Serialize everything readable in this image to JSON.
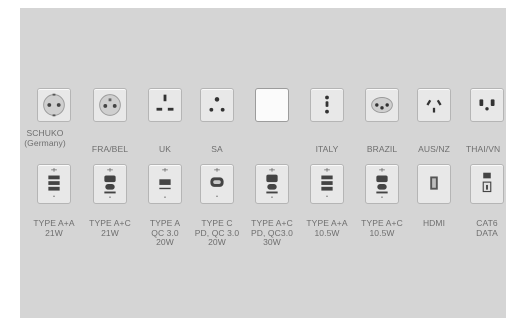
{
  "outlets": [
    {
      "id": "schuko",
      "icon": "schuko-socket-icon",
      "lines": [
        "SCHUKO",
        "(Germany)"
      ]
    },
    {
      "id": "frabel",
      "icon": "fra-bel-socket-icon",
      "lines": [
        "FRA/BEL"
      ]
    },
    {
      "id": "uk",
      "icon": "uk-socket-icon",
      "lines": [
        "UK"
      ]
    },
    {
      "id": "sa",
      "icon": "sa-socket-icon",
      "lines": [
        "SA"
      ]
    },
    {
      "id": "blank",
      "icon": "blank-plate-icon",
      "lines": []
    },
    {
      "id": "italy",
      "icon": "italy-socket-icon",
      "lines": [
        "ITALY"
      ]
    },
    {
      "id": "brazil",
      "icon": "brazil-socket-icon",
      "lines": [
        "BRAZIL"
      ]
    },
    {
      "id": "ausnz",
      "icon": "aus-nz-socket-icon",
      "lines": [
        "AUS/NZ"
      ]
    },
    {
      "id": "thai",
      "icon": "thai-socket-icon",
      "lines": [
        "THAI/VN"
      ]
    }
  ],
  "modules": [
    {
      "id": "typeaa21",
      "icon": "usb-a-a-module-icon",
      "lines": [
        "TYPE A+A",
        "21W"
      ]
    },
    {
      "id": "typeac21",
      "icon": "usb-a-c-module-icon",
      "lines": [
        "TYPE A+C",
        "21W"
      ]
    },
    {
      "id": "typeaqc",
      "icon": "usb-a-qc-module-icon",
      "lines": [
        "TYPE A",
        "QC 3.0",
        "20W"
      ]
    },
    {
      "id": "typecpd",
      "icon": "usb-c-pd-module-icon",
      "lines": [
        "TYPE C",
        "PD, QC 3.0",
        "20W"
      ]
    },
    {
      "id": "typeacpd",
      "icon": "usb-a-c-pd-module-icon",
      "lines": [
        "TYPE A+C",
        "PD, QC3.0",
        "30W"
      ]
    },
    {
      "id": "typeaa105",
      "icon": "usb-a-a-module-icon",
      "lines": [
        "TYPE A+A",
        "10.5W"
      ]
    },
    {
      "id": "typeac105",
      "icon": "usb-a-c-module-icon",
      "lines": [
        "TYPE A+C",
        "10.5W"
      ]
    },
    {
      "id": "hdmi",
      "icon": "hdmi-module-icon",
      "lines": [
        "HDMI"
      ]
    },
    {
      "id": "cat6",
      "icon": "cat6-data-module-icon",
      "lines": [
        "CAT6",
        "DATA"
      ]
    }
  ]
}
